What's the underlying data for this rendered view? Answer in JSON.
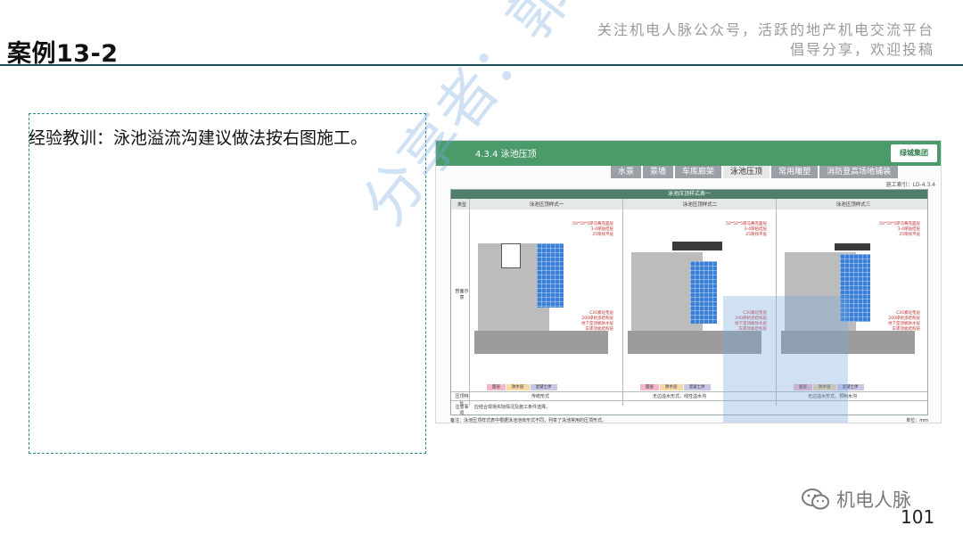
{
  "slide": {
    "title": "案例13-2",
    "promo_line1": "关注机电人脉公众号，活跃的地产机电交流平台",
    "promo_line2": "倡导分享，欢迎投稿",
    "lesson": "经验教训：泳池溢流沟建议做法按右图施工。",
    "watermark": "分享者：郭玉才",
    "brand": "机电人脉",
    "page_number": "101"
  },
  "drawing": {
    "section": "4.3.4 泳池压顶",
    "logo": "绿城集团",
    "tabs": [
      "水景",
      "景墙",
      "车库廊架",
      "泳池压顶",
      "常用雕塑",
      "消防登高场地铺装"
    ],
    "active_tab": "泳池压顶",
    "ref": "施工索引：LD-4.3.4",
    "table_title": "泳池压顶样式表一",
    "row_type": "类型",
    "row_section": "剖面示意",
    "row_cap": "压顶特征",
    "row_note": "注意事项",
    "columns": [
      "泳池压顶样式一",
      "泳池压顶样式二",
      "泳池压顶样式三"
    ],
    "legend": [
      "面层",
      "防水层",
      "混凝土体"
    ],
    "caps": [
      "传统形式",
      "无边溢水形式，线性溢水沟",
      "无边溢水形式，预制水沟"
    ],
    "note_text": "应结合现场实际情况及施工条件选择。",
    "footnote": "备注：泳池压顶样式表中根据泳池池体形式不同，列举了泳池常用的压顶形式。",
    "unit": "单位：mm"
  }
}
